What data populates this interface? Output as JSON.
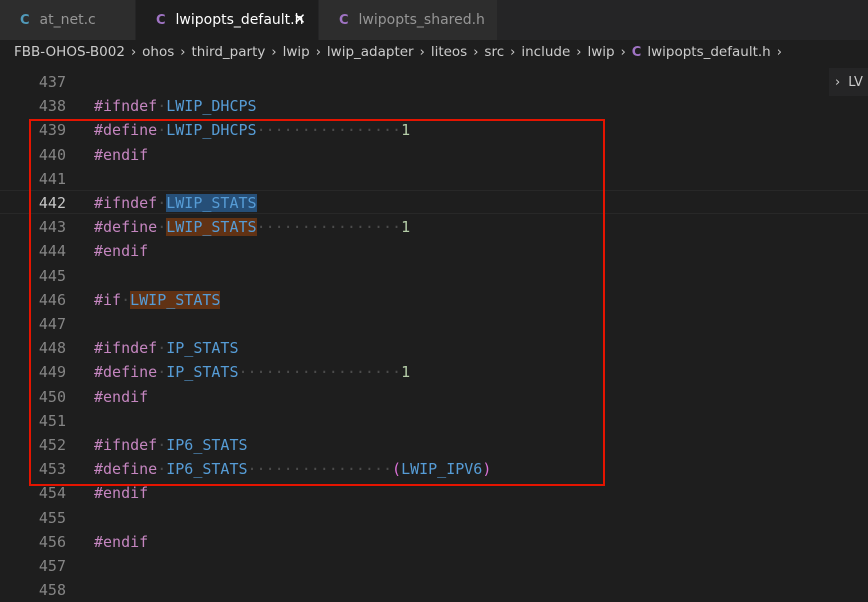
{
  "tabs": [
    {
      "icon": "C",
      "label": "at_net.c",
      "active": false
    },
    {
      "icon": "C",
      "label": "lwipopts_default.h",
      "active": true,
      "close": "✕"
    },
    {
      "icon": "C",
      "label": "lwipopts_shared.h",
      "active": false
    }
  ],
  "breadcrumbs": [
    "FBB-OHOS-B002",
    "ohos",
    "third_party",
    "lwip",
    "lwip_adapter",
    "liteos",
    "src",
    "include",
    "lwip"
  ],
  "breadcrumb_file": {
    "icon": "C",
    "label": "lwipopts_default.h"
  },
  "breadcrumb_sep": "›",
  "right_panel": {
    "chevron": "›",
    "label": "LV"
  },
  "lines": [
    {
      "num": "437",
      "tokens": []
    },
    {
      "num": "438",
      "tokens": [
        [
          "kw",
          "#ifndef"
        ],
        [
          "dots",
          "·"
        ],
        [
          "mac",
          "LWIP_DHCPS"
        ]
      ]
    },
    {
      "num": "439",
      "tokens": [
        [
          "kw",
          "#define"
        ],
        [
          "dots",
          "·"
        ],
        [
          "mac",
          "LWIP_DHCPS"
        ],
        [
          "dots",
          "················"
        ],
        [
          "num",
          "1"
        ]
      ]
    },
    {
      "num": "440",
      "tokens": [
        [
          "kw",
          "#endif"
        ]
      ]
    },
    {
      "num": "441",
      "tokens": []
    },
    {
      "num": "442",
      "tokens": [
        [
          "kw",
          "#ifndef"
        ],
        [
          "dots",
          "·"
        ],
        [
          "mac hl-sel",
          "LWIP_STATS"
        ]
      ],
      "current": true
    },
    {
      "num": "443",
      "tokens": [
        [
          "kw",
          "#define"
        ],
        [
          "dots",
          "·"
        ],
        [
          "mac hl-occ",
          "LWIP_STATS"
        ],
        [
          "dots",
          "················"
        ],
        [
          "num",
          "1"
        ]
      ]
    },
    {
      "num": "444",
      "tokens": [
        [
          "kw",
          "#endif"
        ]
      ]
    },
    {
      "num": "445",
      "tokens": []
    },
    {
      "num": "446",
      "tokens": [
        [
          "kw",
          "#if"
        ],
        [
          "dots",
          "·"
        ],
        [
          "mac hl-occ",
          "LWIP_STATS"
        ]
      ]
    },
    {
      "num": "447",
      "tokens": []
    },
    {
      "num": "448",
      "tokens": [
        [
          "kw",
          "#ifndef"
        ],
        [
          "dots",
          "·"
        ],
        [
          "mac",
          "IP_STATS"
        ]
      ]
    },
    {
      "num": "449",
      "tokens": [
        [
          "kw",
          "#define"
        ],
        [
          "dots",
          "·"
        ],
        [
          "mac",
          "IP_STATS"
        ],
        [
          "dots",
          "··················"
        ],
        [
          "num",
          "1"
        ]
      ]
    },
    {
      "num": "450",
      "tokens": [
        [
          "kw",
          "#endif"
        ]
      ]
    },
    {
      "num": "451",
      "tokens": []
    },
    {
      "num": "452",
      "tokens": [
        [
          "kw",
          "#ifndef"
        ],
        [
          "dots",
          "·"
        ],
        [
          "mac",
          "IP6_STATS"
        ]
      ]
    },
    {
      "num": "453",
      "tokens": [
        [
          "kw",
          "#define"
        ],
        [
          "dots",
          "·"
        ],
        [
          "mac",
          "IP6_STATS"
        ],
        [
          "dots",
          "················"
        ],
        [
          "paren",
          "("
        ],
        [
          "mac",
          "LWIP_IPV6"
        ],
        [
          "paren",
          ")"
        ]
      ]
    },
    {
      "num": "454",
      "tokens": [
        [
          "kw",
          "#endif"
        ]
      ]
    },
    {
      "num": "455",
      "tokens": []
    },
    {
      "num": "456",
      "tokens": [
        [
          "kw",
          "#endif"
        ]
      ]
    },
    {
      "num": "457",
      "tokens": []
    },
    {
      "num": "458",
      "tokens": []
    }
  ],
  "colors": {
    "keyword": "#c586c0",
    "macro": "#569cd6",
    "number": "#b5cea8",
    "highlight_box": "#e51400"
  }
}
